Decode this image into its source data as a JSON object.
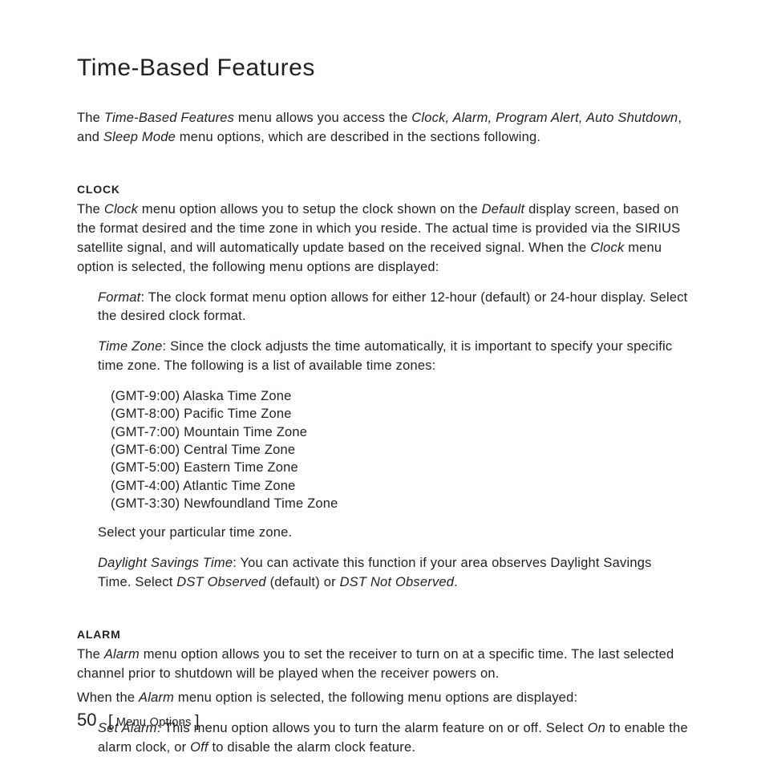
{
  "title": "Time-Based Features",
  "intro": {
    "pre": "The ",
    "em1": "Time-Based Features",
    "mid1": " menu allows you access the ",
    "em2": "Clock, Alarm, Program Alert, Auto Shutdown",
    "mid2": ", and ",
    "em3": "Sleep Mode",
    "post": " menu options, which are described in the sections following."
  },
  "clock": {
    "head": "Clock",
    "p1": {
      "pre": "The ",
      "em1": "Clock",
      "mid1": " menu option allows you to setup the clock shown on the ",
      "em2": "Default",
      "mid2": " display screen, based on the format desired and the time zone in which you reside. The actual time is provided via the SIRIUS satellite signal, and will automatically update based on the received signal. When the ",
      "em3": "Clock",
      "post": " menu option is selected, the following menu options are displayed:"
    },
    "format": {
      "em": "Format",
      "text": ": The clock format menu option allows for either 12-hour (default) or 24-hour display. Select the desired clock format."
    },
    "tz": {
      "em": "Time Zone",
      "text": ": Since the clock adjusts the time automatically, it is important to specify your specific time zone. The following is a list of available time zones:"
    },
    "timezones": [
      "(GMT-9:00) Alaska Time Zone",
      "(GMT-8:00) Pacific Time Zone",
      "(GMT-7:00) Mountain Time Zone",
      "(GMT-6:00) Central Time Zone",
      "(GMT-5:00) Eastern Time Zone",
      "(GMT-4:00) Atlantic Time Zone",
      "(GMT-3:30) Newfoundland Time Zone"
    ],
    "select_tz": "Select your particular time zone.",
    "dst": {
      "em1": "Daylight Savings Time",
      "mid1": ": You can activate this function if your area observes Daylight Savings Time. Select ",
      "em2": "DST Observed",
      "mid2": " (default) or ",
      "em3": "DST Not Observed",
      "post": "."
    }
  },
  "alarm": {
    "head": "Alarm",
    "p1": {
      "pre": "The ",
      "em1": "Alarm",
      "post": " menu option allows you to set the receiver to turn on at a specific time. The last selected channel prior to shutdown will be played when the receiver powers on."
    },
    "p2": {
      "pre": "When the ",
      "em1": "Alarm",
      "post": " menu option is selected, the following menu options are displayed:"
    },
    "set": {
      "em1": "Set Alarm",
      "mid1": ": This menu option allows you to turn the alarm feature on or off. Select ",
      "em2": "On",
      "mid2": " to enable the alarm clock, or ",
      "em3": "Off",
      "post": " to disable the alarm clock feature."
    }
  },
  "footer": {
    "page": "50",
    "lb": "[",
    "label": " Menu Options ",
    "rb": "]"
  }
}
